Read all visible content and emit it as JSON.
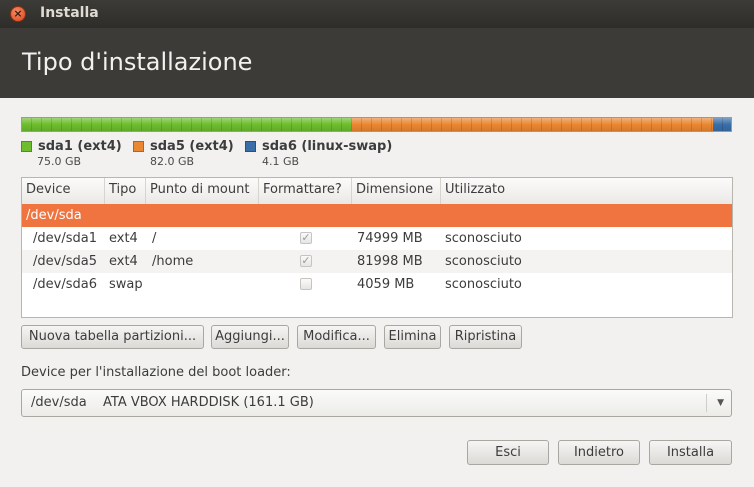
{
  "window": {
    "title": "Installa",
    "close_icon": "×"
  },
  "page": {
    "title": "Tipo d'installazione"
  },
  "colors": {
    "ext4_primary": "#6dbd2e",
    "ext4_logical": "#ea8732",
    "swap": "#3a6ea8",
    "selected_row": "#ef7440"
  },
  "partition_bar": [
    {
      "name": "sda1",
      "fraction": 0.4655,
      "color": "#6dbd2e"
    },
    {
      "name": "sda5",
      "fraction": 0.509,
      "color": "#ea8732"
    },
    {
      "name": "sda6",
      "fraction": 0.0255,
      "color": "#3a6ea8"
    }
  ],
  "legend": [
    {
      "label": "sda1 (ext4)",
      "size": "75.0 GB",
      "color": "#6dbd2e"
    },
    {
      "label": "sda5 (ext4)",
      "size": "82.0 GB",
      "color": "#ea8732"
    },
    {
      "label": "sda6 (linux-swap)",
      "size": "4.1 GB",
      "color": "#3a6ea8"
    }
  ],
  "table": {
    "headers": {
      "device": "Device",
      "type": "Tipo",
      "mount": "Punto di mount",
      "format": "Formattare?",
      "size": "Dimensione",
      "used": "Utilizzato"
    },
    "disk": {
      "device": "/dev/sda"
    },
    "rows": [
      {
        "device": "/dev/sda1",
        "type": "ext4",
        "mount": "/",
        "format": true,
        "size": "74999 MB",
        "used": "sconosciuto"
      },
      {
        "device": "/dev/sda5",
        "type": "ext4",
        "mount": "/home",
        "format": true,
        "size": "81998 MB",
        "used": "sconosciuto"
      },
      {
        "device": "/dev/sda6",
        "type": "swap",
        "mount": "",
        "format": false,
        "size": "4059 MB",
        "used": "sconosciuto"
      }
    ]
  },
  "buttons": {
    "new_table": "Nuova tabella partizioni...",
    "add": "Aggiungi...",
    "edit": "Modifica...",
    "delete": "Elimina",
    "revert": "Ripristina"
  },
  "bootloader": {
    "label": "Device per l'installazione del boot loader:",
    "device": "/dev/sda",
    "description": "ATA VBOX HARDDISK (161.1 GB)"
  },
  "footer": {
    "quit": "Esci",
    "back": "Indietro",
    "install": "Installa"
  }
}
